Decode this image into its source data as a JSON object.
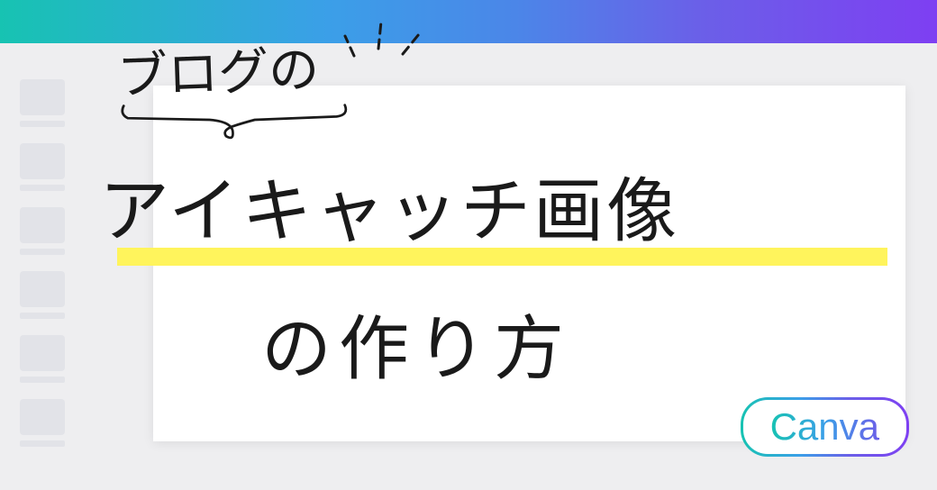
{
  "handwriting": {
    "top_label": "ブログの",
    "main_title": "アイキャッチ画像",
    "subtitle": "の作り方"
  },
  "badge": {
    "label": "Canva"
  }
}
